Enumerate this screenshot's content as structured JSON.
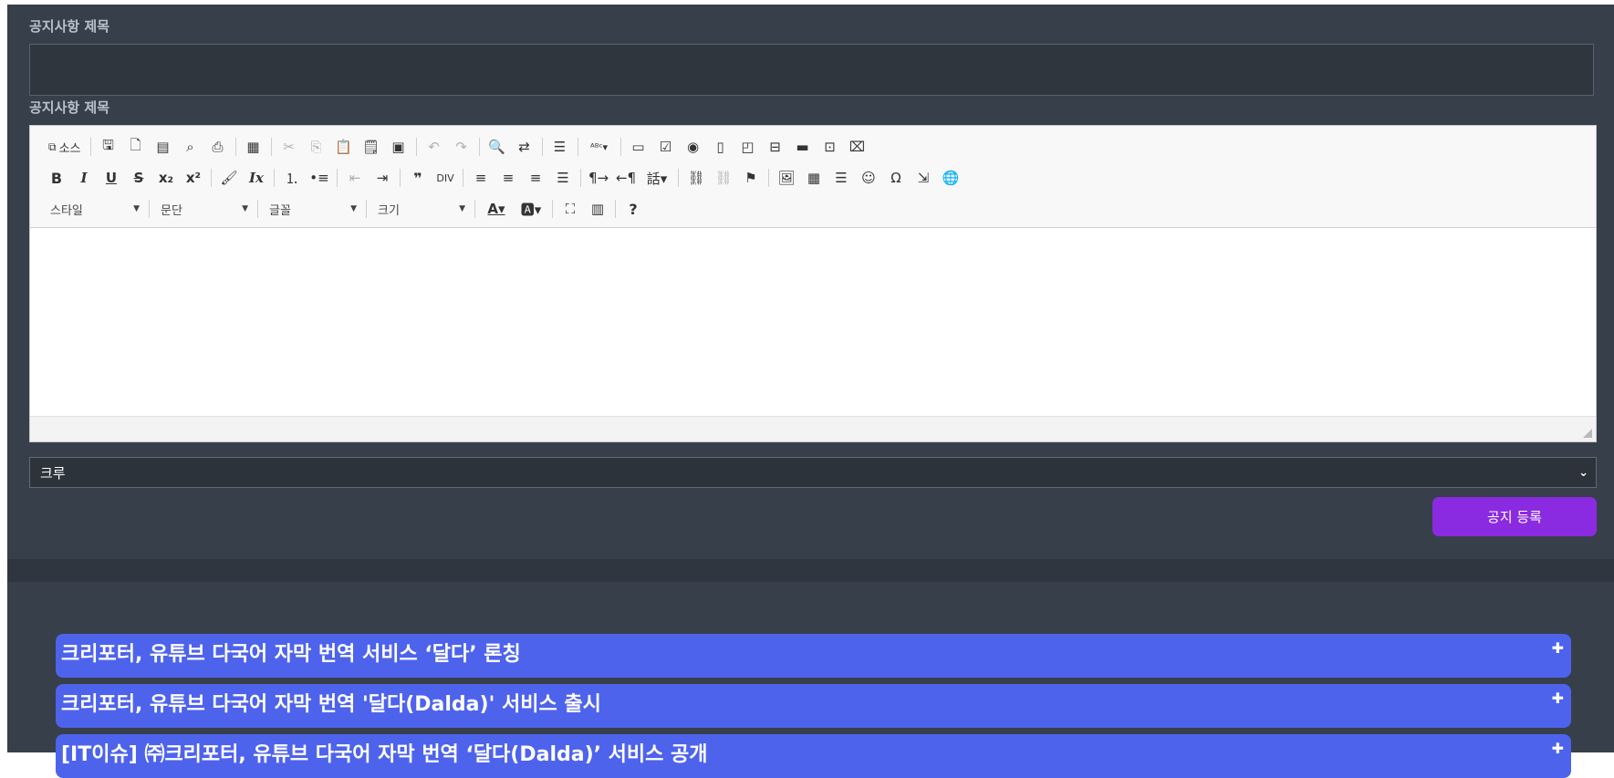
{
  "form": {
    "title_label": "공지사항 제목",
    "title_value": "",
    "content_label": "공지사항 제목",
    "select_value": "크루",
    "submit_label": "공지 등록"
  },
  "toolbar": {
    "source_label": "소스",
    "style_label": "스타일",
    "paragraph_label": "문단",
    "font_label": "글꼴",
    "size_label": "크기",
    "help_label": "?"
  },
  "news": [
    {
      "title": "크리포터, 유튜브 다국어 자막 번역 서비스 ‘달다’ 론칭"
    },
    {
      "title": "크리포터, 유튜브 다국어 자막 번역 '달다(Dalda)' 서비스 출시"
    },
    {
      "title": "[IT이슈] ㈜크리포터, 유튜브 다국어 자막 번역 ‘달다(Dalda)’ 서비스 공개"
    }
  ],
  "icons": {
    "expand": "plus-icon",
    "select_arrow": "chevron-down-icon"
  },
  "colors": {
    "panel": "#373f4a",
    "submit": "#8a2be2",
    "news_item": "#4e63ec"
  }
}
